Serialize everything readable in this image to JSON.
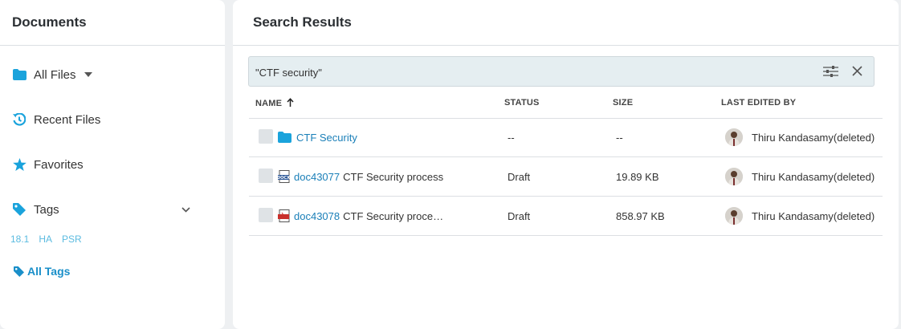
{
  "sidebar": {
    "title": "Documents",
    "items": [
      {
        "label": "All Files",
        "icon": "folder-icon"
      },
      {
        "label": "Recent Files",
        "icon": "history-icon"
      },
      {
        "label": "Favorites",
        "icon": "star-icon"
      },
      {
        "label": "Tags",
        "icon": "tag-icon"
      }
    ],
    "tag_chips": [
      "18.1",
      "HA",
      "PSR"
    ],
    "all_tags_label": "All Tags"
  },
  "main": {
    "title": "Search Results",
    "search": {
      "value": "\"CTF security\""
    },
    "columns": {
      "name": "NAME",
      "status": "STATUS",
      "size": "SIZE",
      "last_edited_by": "LAST EDITED BY"
    },
    "rows": [
      {
        "type": "folder",
        "name": "CTF Security",
        "extra": "",
        "status": "--",
        "size": "--",
        "user": "Thiru Kandasamy(deleted)"
      },
      {
        "type": "docx",
        "name": "doc43077",
        "extra": "CTF Security process",
        "status": "Draft",
        "size": "19.89 KB",
        "user": "Thiru Kandasamy(deleted)"
      },
      {
        "type": "pdf",
        "name": "doc43078",
        "extra": "CTF Security proce…",
        "status": "Draft",
        "size": "858.97 KB",
        "user": "Thiru Kandasamy(deleted)"
      }
    ]
  },
  "colors": {
    "accent": "#1a7fb8",
    "folder": "#1aa3dc",
    "tag_chip": "#5bbbe0",
    "search_bg": "#e5eef1"
  }
}
